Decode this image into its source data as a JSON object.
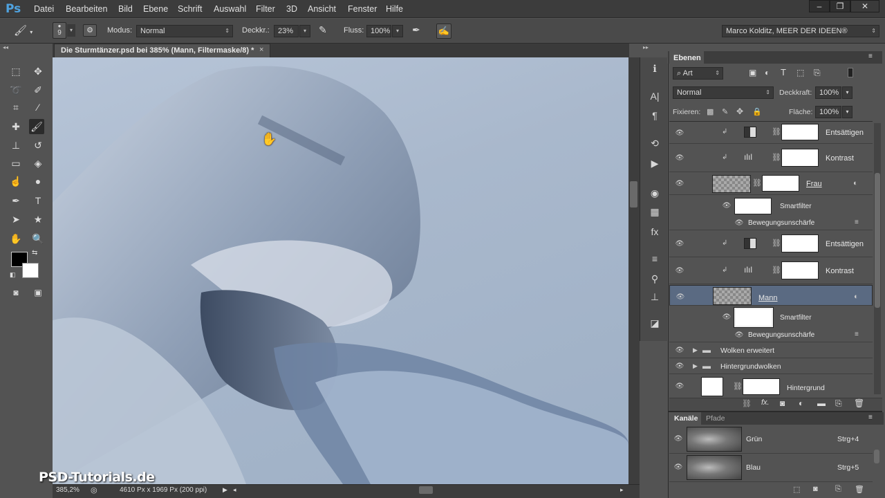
{
  "app": {
    "logo": "Ps"
  },
  "menu": [
    "Datei",
    "Bearbeiten",
    "Bild",
    "Ebene",
    "Schrift",
    "Auswahl",
    "Filter",
    "3D",
    "Ansicht",
    "Fenster",
    "Hilfe"
  ],
  "window_controls": {
    "minimize": "–",
    "restore": "❐",
    "close": "✕"
  },
  "options": {
    "brush_size": "9",
    "mode_label": "Modus:",
    "mode_value": "Normal",
    "opacity_label": "Deckkr.:",
    "opacity_value": "23%",
    "flow_label": "Fluss:",
    "flow_value": "100%",
    "workspace": "Marco Kolditz, MEER DER IDEEN®"
  },
  "document": {
    "tab_title": "Die Sturmtänzer.psd bei 385% (Mann, Filtermaske/8) *",
    "close": "×",
    "zoom": "385,2%",
    "doc_info": "4610 Px x 1969 Px (200 ppi)"
  },
  "watermark": "PSD-Tutorials.de",
  "layers_panel": {
    "tab": "Ebenen",
    "filter_kind": "Art",
    "blend_mode": "Normal",
    "opacity_label": "Deckkraft:",
    "opacity_value": "100%",
    "lock_label": "Fixieren:",
    "fill_label": "Fläche:",
    "fill_value": "100%",
    "layers": [
      {
        "name": "Entsättigen",
        "type": "adjustment"
      },
      {
        "name": "Kontrast",
        "type": "adjustment"
      },
      {
        "name": "Frau",
        "type": "smart"
      },
      {
        "name": "Smartfilter",
        "type": "filtermask"
      },
      {
        "name": "Bewegungsunschärfe",
        "type": "filter"
      },
      {
        "name": "Entsättigen",
        "type": "adjustment"
      },
      {
        "name": "Kontrast",
        "type": "adjustment"
      },
      {
        "name": "Mann",
        "type": "smart",
        "selected": true
      },
      {
        "name": "Smartfilter",
        "type": "filtermask"
      },
      {
        "name": "Bewegungsunschärfe",
        "type": "filter"
      },
      {
        "name": "Wolken erweitert",
        "type": "group"
      },
      {
        "name": "Hintergrundwolken",
        "type": "group"
      },
      {
        "name": "Hintergrund",
        "type": "layer"
      }
    ]
  },
  "channels_panel": {
    "tabs": [
      "Kanäle",
      "Pfade"
    ],
    "channels": [
      {
        "name": "Grün",
        "shortcut": "Strg+4"
      },
      {
        "name": "Blau",
        "shortcut": "Strg+5"
      }
    ]
  },
  "colors": {
    "accent": "#4fa3e0",
    "selected_row": "#5a6a82",
    "panel_bg": "#535353",
    "menubar": "#3c3c3c"
  }
}
